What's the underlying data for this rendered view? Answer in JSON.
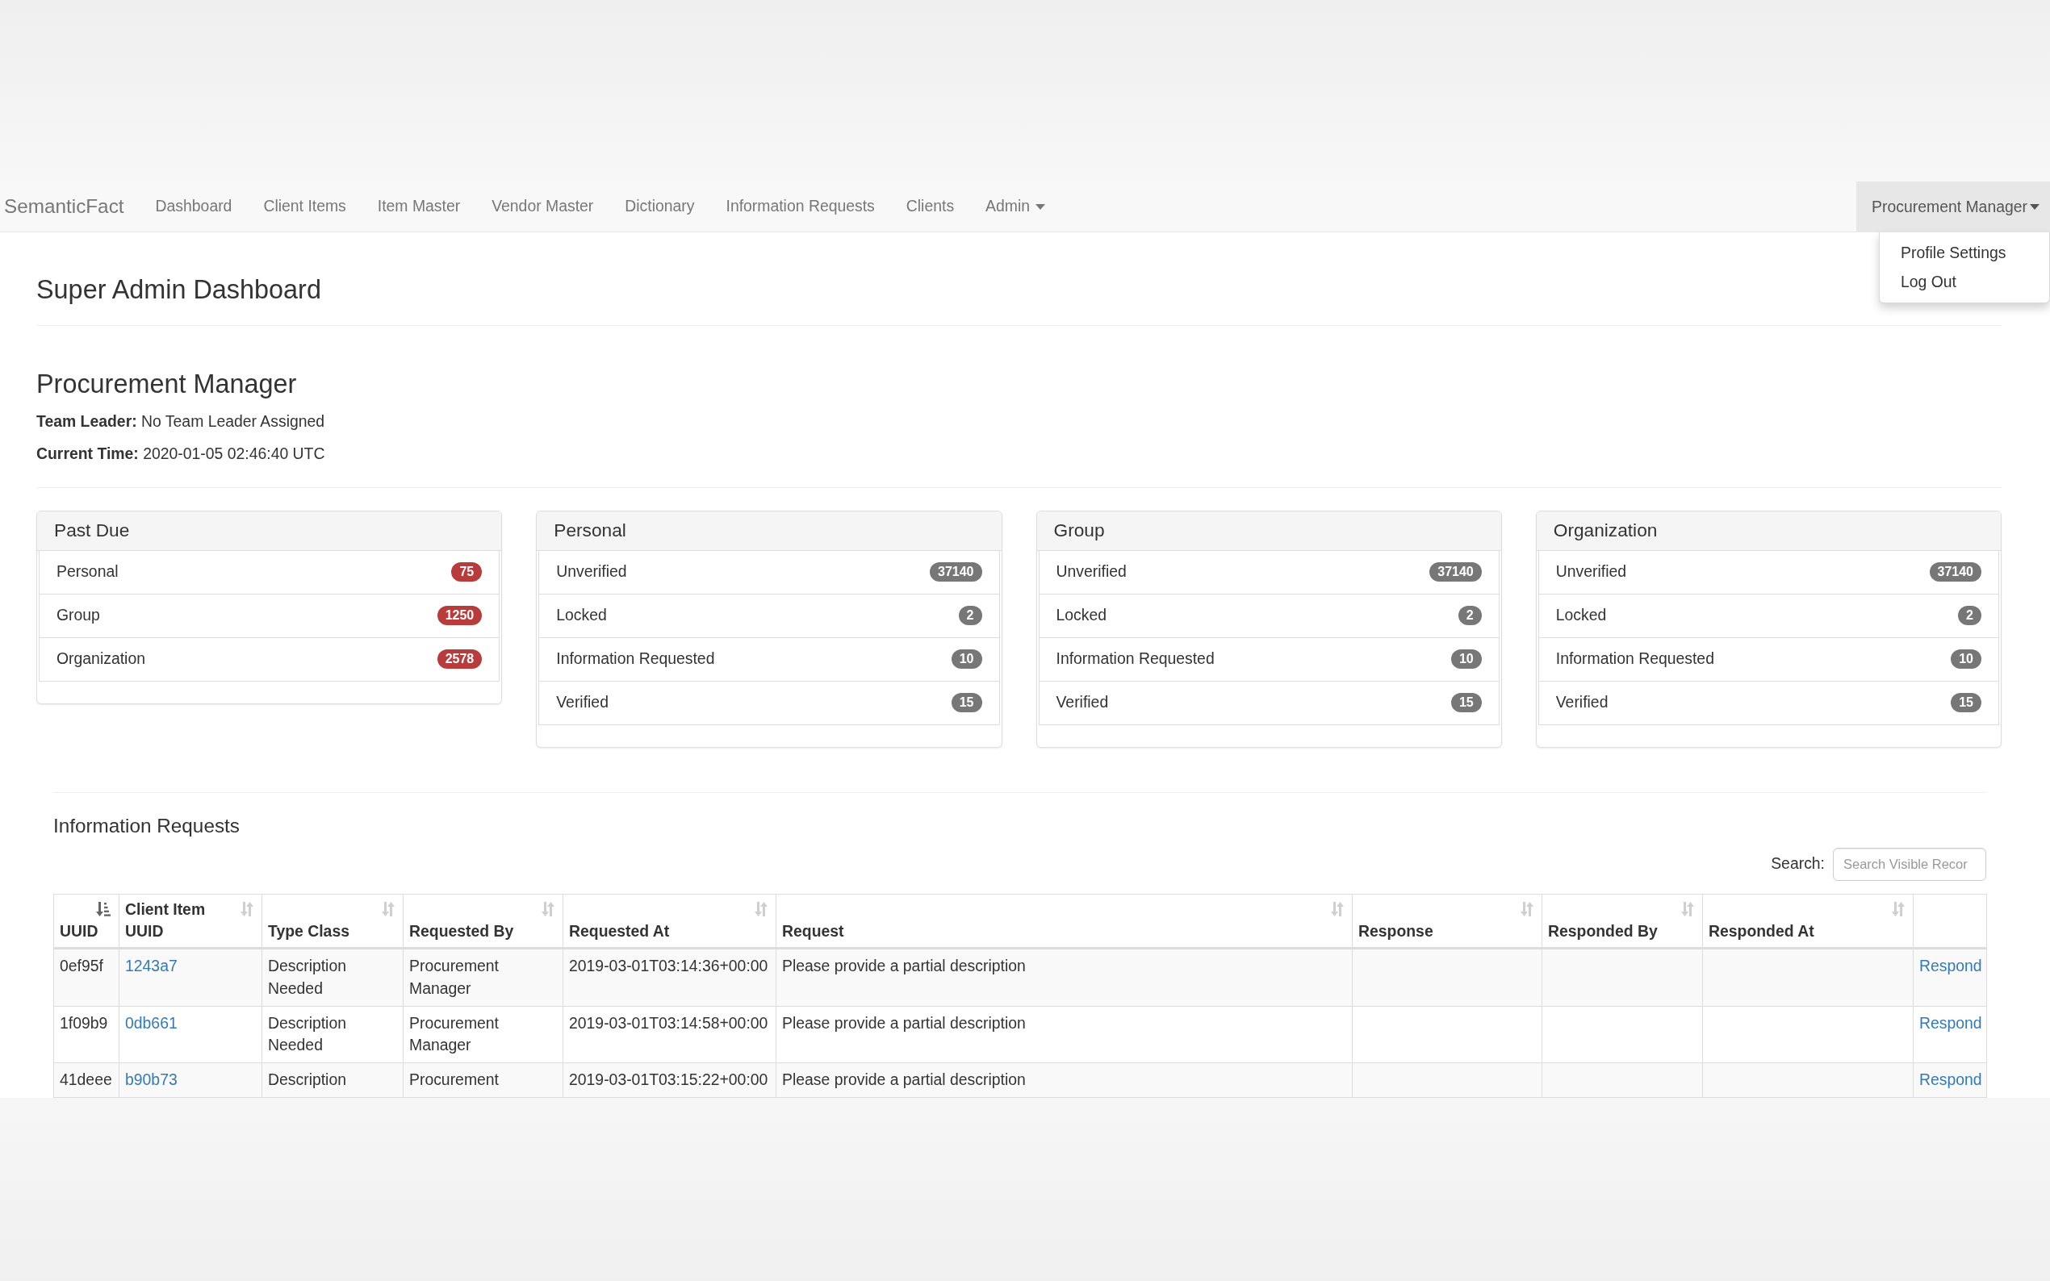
{
  "navbar": {
    "brand": "SemanticFact",
    "links": [
      {
        "label": "Dashboard",
        "kind": "link",
        "selected": false
      },
      {
        "label": "Client Items",
        "kind": "link",
        "selected": false
      },
      {
        "label": "Item Master",
        "kind": "link",
        "selected": false
      },
      {
        "label": "Vendor Master",
        "kind": "link",
        "selected": false
      },
      {
        "label": "Dictionary",
        "kind": "link",
        "selected": false
      },
      {
        "label": "Information Requests",
        "kind": "link",
        "selected": false
      },
      {
        "label": "Clients",
        "kind": "link",
        "selected": false
      },
      {
        "label": "Admin",
        "kind": "dropdown",
        "selected": false
      }
    ],
    "user_menu": {
      "label": "Procurement Manager",
      "expanded": true,
      "items": [
        "Profile Settings",
        "Log Out"
      ]
    }
  },
  "page_title": "Super Admin Dashboard",
  "profile": {
    "name": "Procurement Manager",
    "team_leader": "**Team Leader:** No Team Leader Assigned",
    "current_time": "**Current Time:** 2020-01-05 02:46:40 UTC"
  },
  "cards": [
    {
      "title": "Past Due",
      "color": "#b83c3c",
      "items": [
        {
          "label": "Personal",
          "count": "75"
        },
        {
          "label": "Group",
          "count": "1250"
        },
        {
          "label": "Organization",
          "count": "2578"
        }
      ]
    },
    {
      "title": "Personal",
      "color": "#777777",
      "items": [
        {
          "label": "Unverified",
          "count": "37140"
        },
        {
          "label": "Locked",
          "count": "2"
        },
        {
          "label": "Information Requested",
          "count": "10"
        },
        {
          "label": "Verified",
          "count": "15"
        }
      ]
    },
    {
      "title": "Group",
      "color": "#777777",
      "items": [
        {
          "label": "Unverified",
          "count": "37140"
        },
        {
          "label": "Locked",
          "count": "2"
        },
        {
          "label": "Information Requested",
          "count": "10"
        },
        {
          "label": "Verified",
          "count": "15"
        }
      ]
    },
    {
      "title": "Organization",
      "color": "#777777",
      "items": [
        {
          "label": "Unverified",
          "count": "37140"
        },
        {
          "label": "Locked",
          "count": "2"
        },
        {
          "label": "Information Requested",
          "count": "10"
        },
        {
          "label": "Verified",
          "count": "15"
        }
      ]
    }
  ],
  "requests": {
    "title": "Information Requests",
    "search": {
      "label": "Search:",
      "placeholder": "Search Visible Recor"
    },
    "columns": [
      {
        "label": "UUID",
        "sorted": true
      },
      {
        "label": "Client Item UUID",
        "sorted": false
      },
      {
        "label": "Type Class",
        "sorted": false
      },
      {
        "label": "Requested By",
        "sorted": false
      },
      {
        "label": "Requested At",
        "sorted": false
      },
      {
        "label": "Request",
        "sorted": false
      },
      {
        "label": "Response",
        "sorted": false
      },
      {
        "label": "Responded By",
        "sorted": false
      },
      {
        "label": "Responded At",
        "sorted": false
      }
    ],
    "rows": [
      {
        "uuid": "0ef95f",
        "client_item_uuid": "1243a7",
        "type_class": "Description Needed",
        "requested_by": "Procurement Manager",
        "requested_at": "2019-03-01T03:14:36+00:00",
        "request": "Please provide a partial description",
        "action": "Respond"
      },
      {
        "uuid": "1f09b9",
        "client_item_uuid": "0db661",
        "type_class": "Description Needed",
        "requested_by": "Procurement Manager",
        "requested_at": "2019-03-01T03:14:58+00:00",
        "request": "Please provide a partial description",
        "action": "Respond"
      },
      {
        "uuid": "41deee",
        "client_item_uuid": "b90b73",
        "type_class": "Description",
        "requested_by": "Procurement",
        "requested_at": "2019-03-01T03:15:22+00:00",
        "request": "Please provide a partial description",
        "action": "Respond"
      }
    ]
  }
}
